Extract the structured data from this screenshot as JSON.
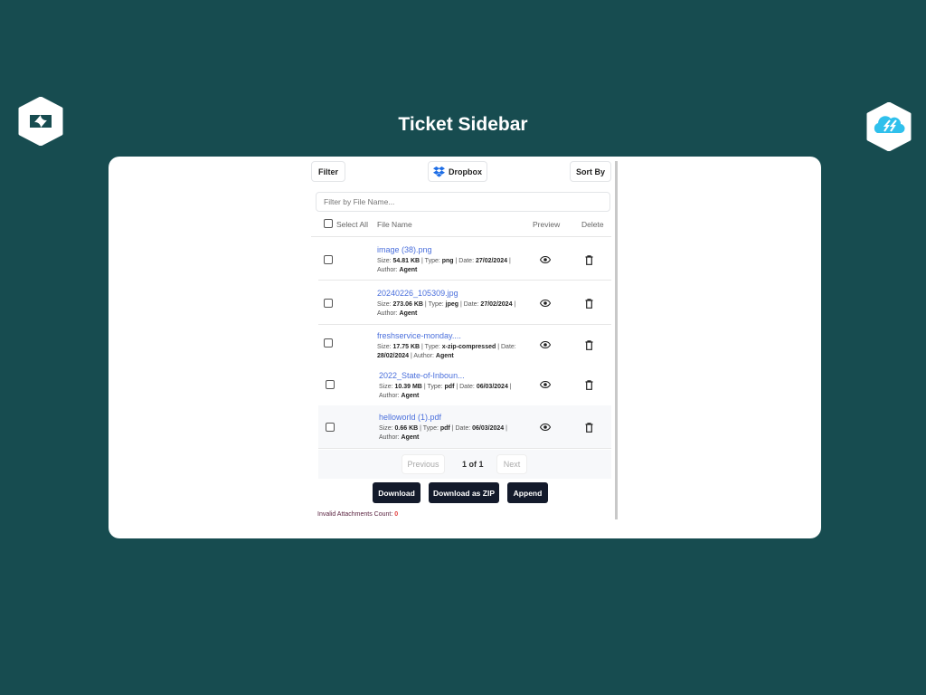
{
  "header": {
    "title": "Ticket Sidebar",
    "left_logo": "zendesk-logo",
    "right_logo": "freshservice-cloud-logo"
  },
  "toolbar": {
    "filter": "Filter",
    "dropbox": "Dropbox",
    "sort": "Sort By"
  },
  "search": {
    "placeholder": "Filter by File Name..."
  },
  "table": {
    "select_all": "Select All",
    "col_file": "File Name",
    "col_preview": "Preview",
    "col_delete": "Delete"
  },
  "files": [
    {
      "name": "image (38).png",
      "size": "54.81 KB",
      "type": "png",
      "date": "27/02/2024",
      "author": "Agent"
    },
    {
      "name": "20240226_105309.jpg",
      "size": "273.06 KB",
      "type": "jpeg",
      "date": "27/02/2024",
      "author": "Agent"
    },
    {
      "name": "freshservice-monday....",
      "size": "17.75 KB",
      "type": "x-zip-compressed",
      "date": "28/02/2024",
      "author": "Agent"
    },
    {
      "name": "2022_State-of-Inboun...",
      "size": "10.39 MB",
      "type": "pdf",
      "date": "06/03/2024",
      "author": "Agent"
    },
    {
      "name": "helloworld (1).pdf",
      "size": "0.66 KB",
      "type": "pdf",
      "date": "06/03/2024",
      "author": "Agent"
    }
  ],
  "labels": {
    "size": "Size: ",
    "type": " | Type: ",
    "date": " | Date: ",
    "author": "Author: ",
    "sep": " |"
  },
  "pagination": {
    "previous": "Previous",
    "page": "1 of 1",
    "next": "Next"
  },
  "actions": {
    "download": "Download",
    "zip": "Download as ZIP",
    "append": "Append"
  },
  "footer": {
    "invalid_label": "Invalid Attachments Count: ",
    "invalid_count": "0"
  }
}
